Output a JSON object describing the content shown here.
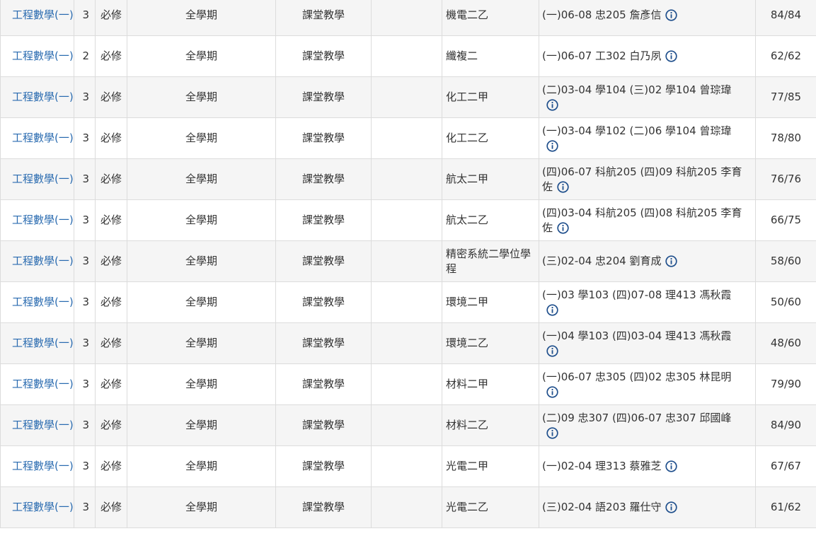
{
  "table": {
    "rows": [
      {
        "course": "工程數學(一)",
        "credits": "3",
        "type": "必修",
        "term": "全學期",
        "mode": "課堂教學",
        "class": "機電二乙",
        "schedule": "(一)06-08 忠205 詹彥信",
        "quota": "84/84"
      },
      {
        "course": "工程數學(一)",
        "credits": "2",
        "type": "必修",
        "term": "全學期",
        "mode": "課堂教學",
        "class": "纖複二",
        "schedule": "(一)06-07 工302 白乃夙",
        "quota": "62/62"
      },
      {
        "course": "工程數學(一)",
        "credits": "3",
        "type": "必修",
        "term": "全學期",
        "mode": "課堂教學",
        "class": "化工二甲",
        "schedule": "(二)03-04 學104 (三)02 學104 曾琮瑋",
        "quota": "77/85"
      },
      {
        "course": "工程數學(一)",
        "credits": "3",
        "type": "必修",
        "term": "全學期",
        "mode": "課堂教學",
        "class": "化工二乙",
        "schedule": "(一)03-04 學102 (二)06 學104 曾琮瑋",
        "quota": "78/80"
      },
      {
        "course": "工程數學(一)",
        "credits": "3",
        "type": "必修",
        "term": "全學期",
        "mode": "課堂教學",
        "class": "航太二甲",
        "schedule": "(四)06-07 科航205 (四)09 科航205 李育佐",
        "quota": "76/76"
      },
      {
        "course": "工程數學(一)",
        "credits": "3",
        "type": "必修",
        "term": "全學期",
        "mode": "課堂教學",
        "class": "航太二乙",
        "schedule": "(四)03-04 科航205 (四)08 科航205 李育佐",
        "quota": "66/75"
      },
      {
        "course": "工程數學(一)",
        "credits": "3",
        "type": "必修",
        "term": "全學期",
        "mode": "課堂教學",
        "class": "精密系統二學位學程",
        "schedule": "(三)02-04 忠204 劉育成",
        "quota": "58/60"
      },
      {
        "course": "工程數學(一)",
        "credits": "3",
        "type": "必修",
        "term": "全學期",
        "mode": "課堂教學",
        "class": "環境二甲",
        "schedule": "(一)03 學103 (四)07-08 理413 馮秋霞",
        "quota": "50/60"
      },
      {
        "course": "工程數學(一)",
        "credits": "3",
        "type": "必修",
        "term": "全學期",
        "mode": "課堂教學",
        "class": "環境二乙",
        "schedule": "(一)04 學103 (四)03-04 理413 馮秋霞",
        "quota": "48/60"
      },
      {
        "course": "工程數學(一)",
        "credits": "3",
        "type": "必修",
        "term": "全學期",
        "mode": "課堂教學",
        "class": "材料二甲",
        "schedule": "(一)06-07 忠305 (四)02 忠305 林昆明",
        "quota": "79/90"
      },
      {
        "course": "工程數學(一)",
        "credits": "3",
        "type": "必修",
        "term": "全學期",
        "mode": "課堂教學",
        "class": "材料二乙",
        "schedule": "(二)09 忠307 (四)06-07 忠307 邱國峰",
        "quota": "84/90"
      },
      {
        "course": "工程數學(一)",
        "credits": "3",
        "type": "必修",
        "term": "全學期",
        "mode": "課堂教學",
        "class": "光電二甲",
        "schedule": "(一)02-04 理313 蔡雅芝",
        "quota": "67/67"
      },
      {
        "course": "工程數學(一)",
        "credits": "3",
        "type": "必修",
        "term": "全學期",
        "mode": "課堂教學",
        "class": "光電二乙",
        "schedule": "(三)02-04 語203 羅仕守",
        "quota": "61/62"
      }
    ]
  },
  "icons": {
    "info": "info-circle-icon"
  },
  "colors": {
    "link": "#2a6bb0",
    "icon": "#1f4f8c",
    "stripe": "#f5f5f5",
    "border": "#dcdcdc"
  }
}
